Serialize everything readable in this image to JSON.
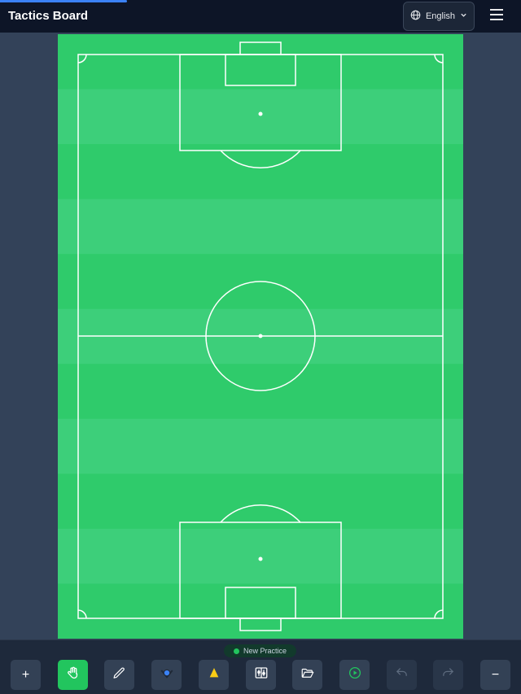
{
  "header": {
    "title": "Tactics Board",
    "language": "English",
    "globe_icon": "globe-icon",
    "language_chevron_icon": "chevron-down-icon",
    "menu_icon": "hamburger-menu-icon"
  },
  "pitch": {
    "grass_light": "#3dcf7a",
    "grass_dark": "#2fcb6b",
    "line_color": "#ffffff"
  },
  "status": {
    "label": "New Practice",
    "dot_color": "#22c55e"
  },
  "toolbar": {
    "accent": "#22c55e",
    "tools": [
      {
        "name": "add-button",
        "icon": "plus-icon",
        "glyph": "+"
      },
      {
        "name": "pan-tool-button",
        "icon": "hand-icon",
        "active": true
      },
      {
        "name": "draw-tool-button",
        "icon": "pencil-icon"
      },
      {
        "name": "ball-tool-button",
        "icon": "ball-icon"
      },
      {
        "name": "cone-tool-button",
        "icon": "cone-icon"
      },
      {
        "name": "formation-tool-button",
        "icon": "sliders-icon"
      },
      {
        "name": "open-file-button",
        "icon": "folder-open-icon"
      },
      {
        "name": "play-animation-button",
        "icon": "play-circle-icon"
      },
      {
        "name": "undo-button",
        "icon": "undo-icon",
        "disabled": true
      },
      {
        "name": "redo-button",
        "icon": "redo-icon",
        "disabled": true
      },
      {
        "name": "zoom-out-button",
        "icon": "minus-icon",
        "glyph": "−"
      }
    ]
  }
}
